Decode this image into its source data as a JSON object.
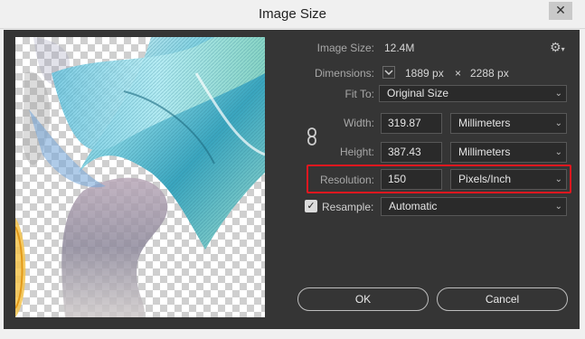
{
  "window": {
    "title": "Image Size",
    "close_symbol": "✕"
  },
  "image_size": {
    "label": "Image Size:",
    "value": "12.4M"
  },
  "dimensions": {
    "label": "Dimensions:",
    "width": "1889 px",
    "separator": "×",
    "height": "2288 px"
  },
  "fit_to": {
    "label": "Fit To:",
    "value": "Original Size"
  },
  "width": {
    "label": "Width:",
    "value": "319.87",
    "unit": "Millimeters"
  },
  "height": {
    "label": "Height:",
    "value": "387.43",
    "unit": "Millimeters"
  },
  "resolution": {
    "label": "Resolution:",
    "value": "150",
    "unit": "Pixels/Inch"
  },
  "resample": {
    "label": "Resample:",
    "checked": true,
    "value": "Automatic"
  },
  "buttons": {
    "ok": "OK",
    "cancel": "Cancel"
  },
  "icons": {
    "gear": "gear-icon",
    "link": "link-chain-icon",
    "dropdown": "chevron-down-icon",
    "close": "close-icon"
  },
  "colors": {
    "dialog_bg": "#353535",
    "highlight": "#e5171f",
    "field_bg": "#2a2a2a"
  }
}
